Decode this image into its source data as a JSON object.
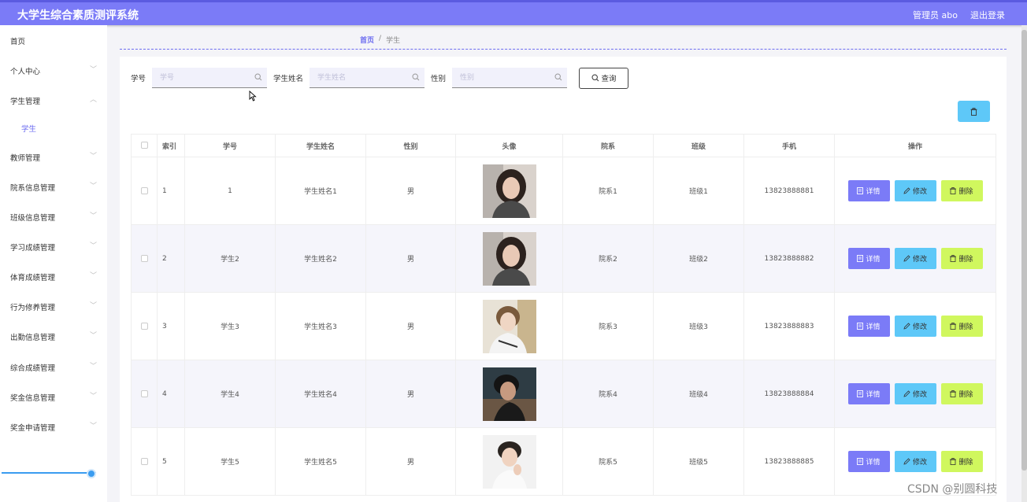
{
  "app": {
    "title": "大学生综合素质测评系统",
    "user_label": "管理员 abo",
    "logout_label": "退出登录"
  },
  "sidebar": {
    "items": [
      {
        "label": "首页"
      },
      {
        "label": "个人中心"
      },
      {
        "label": "学生管理"
      },
      {
        "label": "学生"
      },
      {
        "label": "教师管理"
      },
      {
        "label": "院系信息管理"
      },
      {
        "label": "班级信息管理"
      },
      {
        "label": "学习成绩管理"
      },
      {
        "label": "体育成绩管理"
      },
      {
        "label": "行为修养管理"
      },
      {
        "label": "出勤信息管理"
      },
      {
        "label": "综合成绩管理"
      },
      {
        "label": "奖金信息管理"
      },
      {
        "label": "奖金申请管理"
      }
    ]
  },
  "breadcrumb": {
    "home": "首页",
    "sep": "/",
    "current": "学生"
  },
  "search": {
    "xuehao_label": "学号",
    "xuehao_placeholder": "学号",
    "xuehao_value": "",
    "name_label": "学生姓名",
    "name_placeholder": "学生姓名",
    "name_value": "",
    "gender_label": "性别",
    "gender_placeholder": "性别",
    "gender_value": "",
    "query_label": "查询"
  },
  "table": {
    "headers": {
      "index": "索引",
      "xuehao": "学号",
      "name": "学生姓名",
      "gender": "性别",
      "avatar": "头像",
      "dept": "院系",
      "class": "班级",
      "phone": "手机",
      "ops": "操作"
    },
    "buttons": {
      "detail": "详情",
      "edit": "修改",
      "delete": "删除"
    },
    "rows": [
      {
        "index": "1",
        "xuehao": "1",
        "name": "学生姓名1",
        "gender": "男",
        "dept": "院系1",
        "class": "班级1",
        "phone": "13823888881"
      },
      {
        "index": "2",
        "xuehao": "学生2",
        "name": "学生姓名2",
        "gender": "男",
        "dept": "院系2",
        "class": "班级2",
        "phone": "13823888882"
      },
      {
        "index": "3",
        "xuehao": "学生3",
        "name": "学生姓名3",
        "gender": "男",
        "dept": "院系3",
        "class": "班级3",
        "phone": "13823888883"
      },
      {
        "index": "4",
        "xuehao": "学生4",
        "name": "学生姓名4",
        "gender": "男",
        "dept": "院系4",
        "class": "班级4",
        "phone": "13823888884"
      },
      {
        "index": "5",
        "xuehao": "学生5",
        "name": "学生姓名5",
        "gender": "男",
        "dept": "院系5",
        "class": "班级5",
        "phone": "13823888885"
      }
    ]
  },
  "watermark": "CSDN @别圆科技",
  "colors": {
    "primary": "#7b7bf7",
    "cyan": "#5ec8f8",
    "lime": "#d0f75e"
  }
}
